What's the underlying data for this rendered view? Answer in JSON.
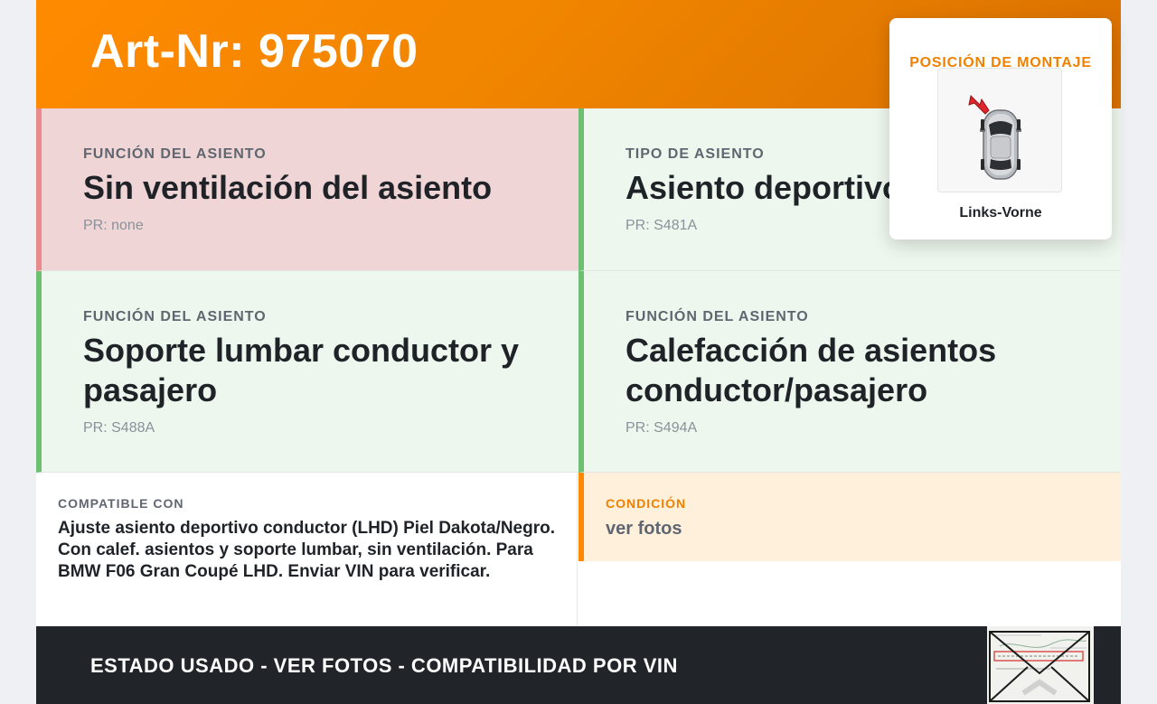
{
  "header": {
    "title": "Art-Nr: 975070"
  },
  "features": [
    {
      "label": "FUNCIÓN DEL ASIENTO",
      "value": "Sin ventilación del asiento",
      "pr": "PR: none",
      "status": "negative"
    },
    {
      "label": "TIPO DE ASIENTO",
      "value": "Asiento deportivo",
      "pr": "PR: S481A",
      "status": "positive"
    },
    {
      "label": "FUNCIÓN DEL ASIENTO",
      "value": "Soporte lumbar conductor y pasajero",
      "pr": "PR: S488A",
      "status": "positive"
    },
    {
      "label": "FUNCIÓN DEL ASIENTO",
      "value": "Calefacción de asientos conductor/pasajero",
      "pr": "PR: S494A",
      "status": "positive"
    }
  ],
  "compatible": {
    "label": "COMPATIBLE CON",
    "text": "Ajuste asiento deportivo conductor (LHD) Piel Dakota/Negro. Con calef. asientos y soporte lumbar, sin ventilación. Para BMW F06 Gran Coupé LHD. Enviar VIN para verificar."
  },
  "condition": {
    "label": "CONDICIÓN",
    "text": "ver fotos"
  },
  "footer": {
    "text": "ESTADO USADO - VER FOTOS - COMPATIBILIDAD POR VIN"
  },
  "mounting": {
    "title": "POSICIÓN DE MONTAJE",
    "position": "Links-Vorne",
    "icon": "car-top-view-icon"
  },
  "colors": {
    "accent": "#ff8a00",
    "negative_bg": "#efd5d6",
    "negative_border": "#e98a8d",
    "positive_bg": "#eef7ee",
    "positive_border": "#6dc071",
    "footer_bg": "#212428"
  }
}
